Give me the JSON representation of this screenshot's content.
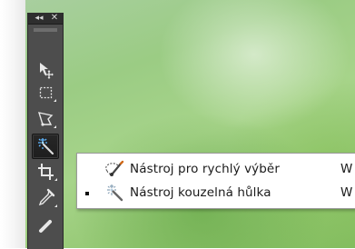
{
  "colors": {
    "toolbar_bg": "#4d4d4d",
    "toolbar_header": "#2e2e2e",
    "flyout_bg": "#ffffff",
    "text": "#1a1a1a"
  },
  "toolbar": {
    "collapse_glyph": "◂◂",
    "close_glyph": "✕",
    "tools": [
      {
        "name": "move-tool",
        "icon": "move-arrow-icon"
      },
      {
        "name": "rectangular-marquee-tool",
        "icon": "marquee-icon"
      },
      {
        "name": "lasso-tool",
        "icon": "polygonal-lasso-icon"
      },
      {
        "name": "magic-wand-tool",
        "icon": "magic-wand-icon",
        "selected": true
      },
      {
        "name": "crop-tool",
        "icon": "crop-icon"
      },
      {
        "name": "eyedropper-tool",
        "icon": "eyedropper-icon"
      }
    ]
  },
  "flyout": {
    "items": [
      {
        "label": "Nástroj pro rychlý výběr",
        "shortcut": "W",
        "icon": "quick-selection-icon",
        "active": false
      },
      {
        "label": "Nástroj kouzelná hůlka",
        "shortcut": "W",
        "icon": "magic-wand-icon",
        "active": true
      }
    ]
  }
}
